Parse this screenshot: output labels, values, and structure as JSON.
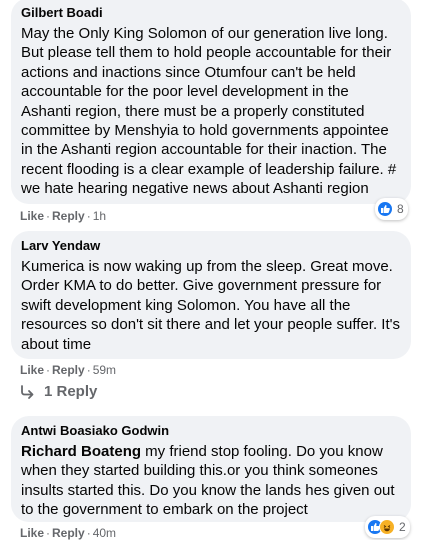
{
  "comments": [
    {
      "author": "Gilbert Boadi",
      "text": "May the Only King Solomon of our generation live long. But please tell them to hold people accountable for their actions and inactions since Otumfour can't be held accountable for the poor level development in the Ashanti region, there must be a properly constituted committee by Menshyia to hold governments appointee in the Ashanti region accountable for their inaction. The recent flooding is a clear example of leadership failure. # we hate hearing negative news about Ashanti region",
      "like_label": "Like",
      "reply_label": "Reply",
      "time": "1h",
      "reaction_count": "8"
    },
    {
      "author": "Larv Yendaw",
      "text": "Kumerica is now waking up from the sleep. Great move. Order KMA to do better. Give government pressure for swift development king Solomon. You have all the resources so don't sit there and let your people suffer. It's about time",
      "like_label": "Like",
      "reply_label": "Reply",
      "time": "59m",
      "replies_label": "1 Reply"
    },
    {
      "author": "Antwi Boasiako Godwin",
      "mention": "Richard Boateng",
      "text": " my friend stop fooling. Do you know when they started building this.or you think someones insults started this. Do you know the lands hes given out to the government to embark on the project",
      "like_label": "Like",
      "reply_label": "Reply",
      "time": "40m",
      "reaction_count": "2"
    }
  ],
  "colors": {
    "bubble": "#f0f2f5",
    "meta_text": "#65676b",
    "like_blue": "#1877f2",
    "haha_yellow": "#f7b125"
  }
}
